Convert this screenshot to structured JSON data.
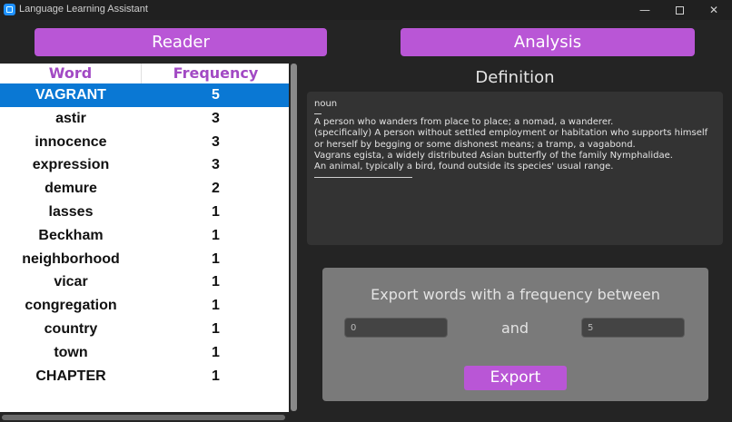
{
  "window": {
    "title": "Language Learning Assistant",
    "minimize_glyph": "—",
    "close_glyph": "✕"
  },
  "nav": {
    "reader_label": "Reader",
    "analysis_label": "Analysis"
  },
  "table": {
    "headers": {
      "word": "Word",
      "frequency": "Frequency"
    },
    "selected_index": 0,
    "rows": [
      {
        "word": "VAGRANT",
        "frequency": "5"
      },
      {
        "word": "astir",
        "frequency": "3"
      },
      {
        "word": "innocence",
        "frequency": "3"
      },
      {
        "word": "expression",
        "frequency": "3"
      },
      {
        "word": "demure",
        "frequency": "2"
      },
      {
        "word": "lasses",
        "frequency": "1"
      },
      {
        "word": "Beckham",
        "frequency": "1"
      },
      {
        "word": "neighborhood",
        "frequency": "1"
      },
      {
        "word": "vicar",
        "frequency": "1"
      },
      {
        "word": "congregation",
        "frequency": "1"
      },
      {
        "word": "country",
        "frequency": "1"
      },
      {
        "word": "town",
        "frequency": "1"
      },
      {
        "word": "CHAPTER",
        "frequency": "1"
      }
    ]
  },
  "definition": {
    "title": "Definition",
    "part_of_speech": "noun",
    "lines": [
      "A person who wanders from place to place; a nomad, a wanderer.",
      "(specifically) A person without settled employment or habitation who supports himself or herself by begging or some dishonest means; a tramp, a vagabond.",
      "Vagrans egista, a widely distributed Asian butterfly of the family Nymphalidae.",
      "An animal, typically a bird, found outside its species' usual range."
    ]
  },
  "export": {
    "label": "Export words with a frequency between",
    "and_label": "and",
    "min_value": "0",
    "max_value": "5",
    "button_label": "Export"
  },
  "colors": {
    "accent": "#b956d6",
    "selection": "#0a78d4",
    "header_text": "#a24ac4"
  }
}
